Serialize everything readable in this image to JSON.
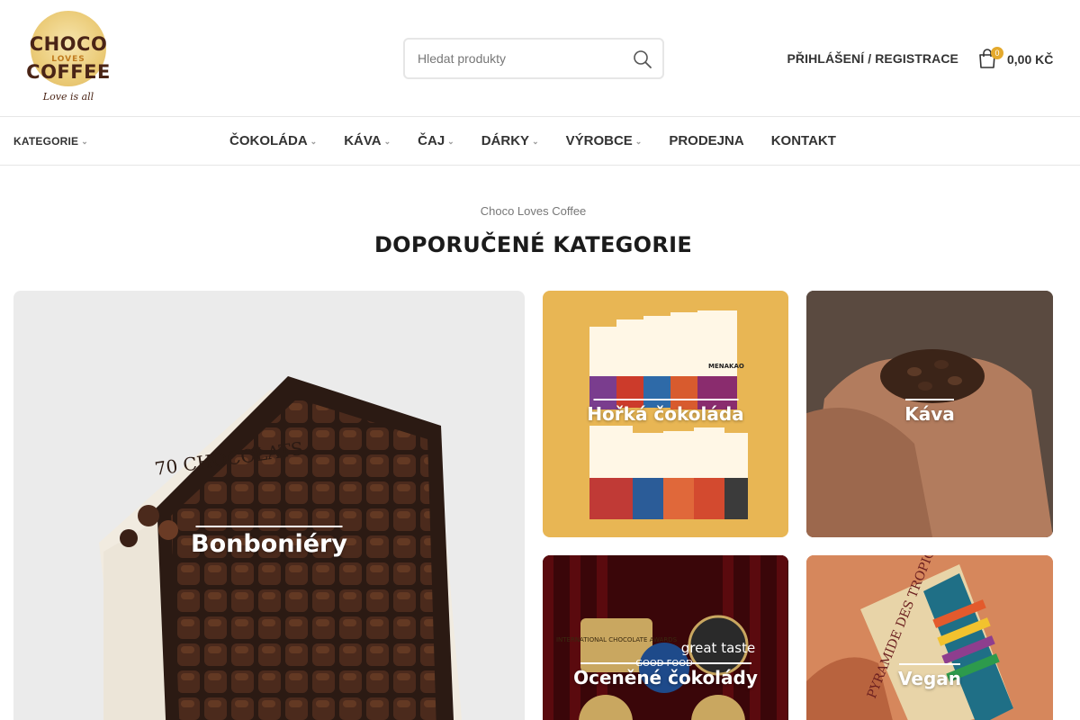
{
  "logo": {
    "line1": "CHOCO",
    "line2": "LOVES",
    "line3": "COFFEE",
    "tagline": "Love is all"
  },
  "search": {
    "placeholder": "Hledat produkty"
  },
  "account": {
    "label": "PŘIHLÁŠENÍ / REGISTRACE"
  },
  "cart": {
    "count": "0",
    "total": "0,00 KČ"
  },
  "nav": {
    "categories_label": "KATEGORIE",
    "items": [
      {
        "label": "ČOKOLÁDA",
        "has_dropdown": true
      },
      {
        "label": "KÁVA",
        "has_dropdown": true
      },
      {
        "label": "ČAJ",
        "has_dropdown": true
      },
      {
        "label": "DÁRKY",
        "has_dropdown": true
      },
      {
        "label": "VÝROBCE",
        "has_dropdown": true
      },
      {
        "label": "PRODEJNA",
        "has_dropdown": false
      },
      {
        "label": "KONTAKT",
        "has_dropdown": false
      }
    ]
  },
  "section": {
    "subtitle": "Choco Loves Coffee",
    "title": "DOPORUČENÉ KATEGORIE"
  },
  "categories": [
    {
      "label": "Bonboniéry",
      "box_text": "70 CHOCOLATS"
    },
    {
      "label": "Hořká čokoláda",
      "wrapper_text": "MENAKAO"
    },
    {
      "label": "Káva"
    },
    {
      "label": "Oceněné čokolády",
      "award_1": "INTERNATIONAL CHOCOLATE AWARDS",
      "award_2": "great taste",
      "award_3": "GOOD FOOD"
    },
    {
      "label": "Vegan",
      "bar_text": "PYRAMIDE DES TROPIQUES"
    }
  ],
  "colors": {
    "accent": "#e4a92c",
    "brand_brown": "#4a2416"
  }
}
